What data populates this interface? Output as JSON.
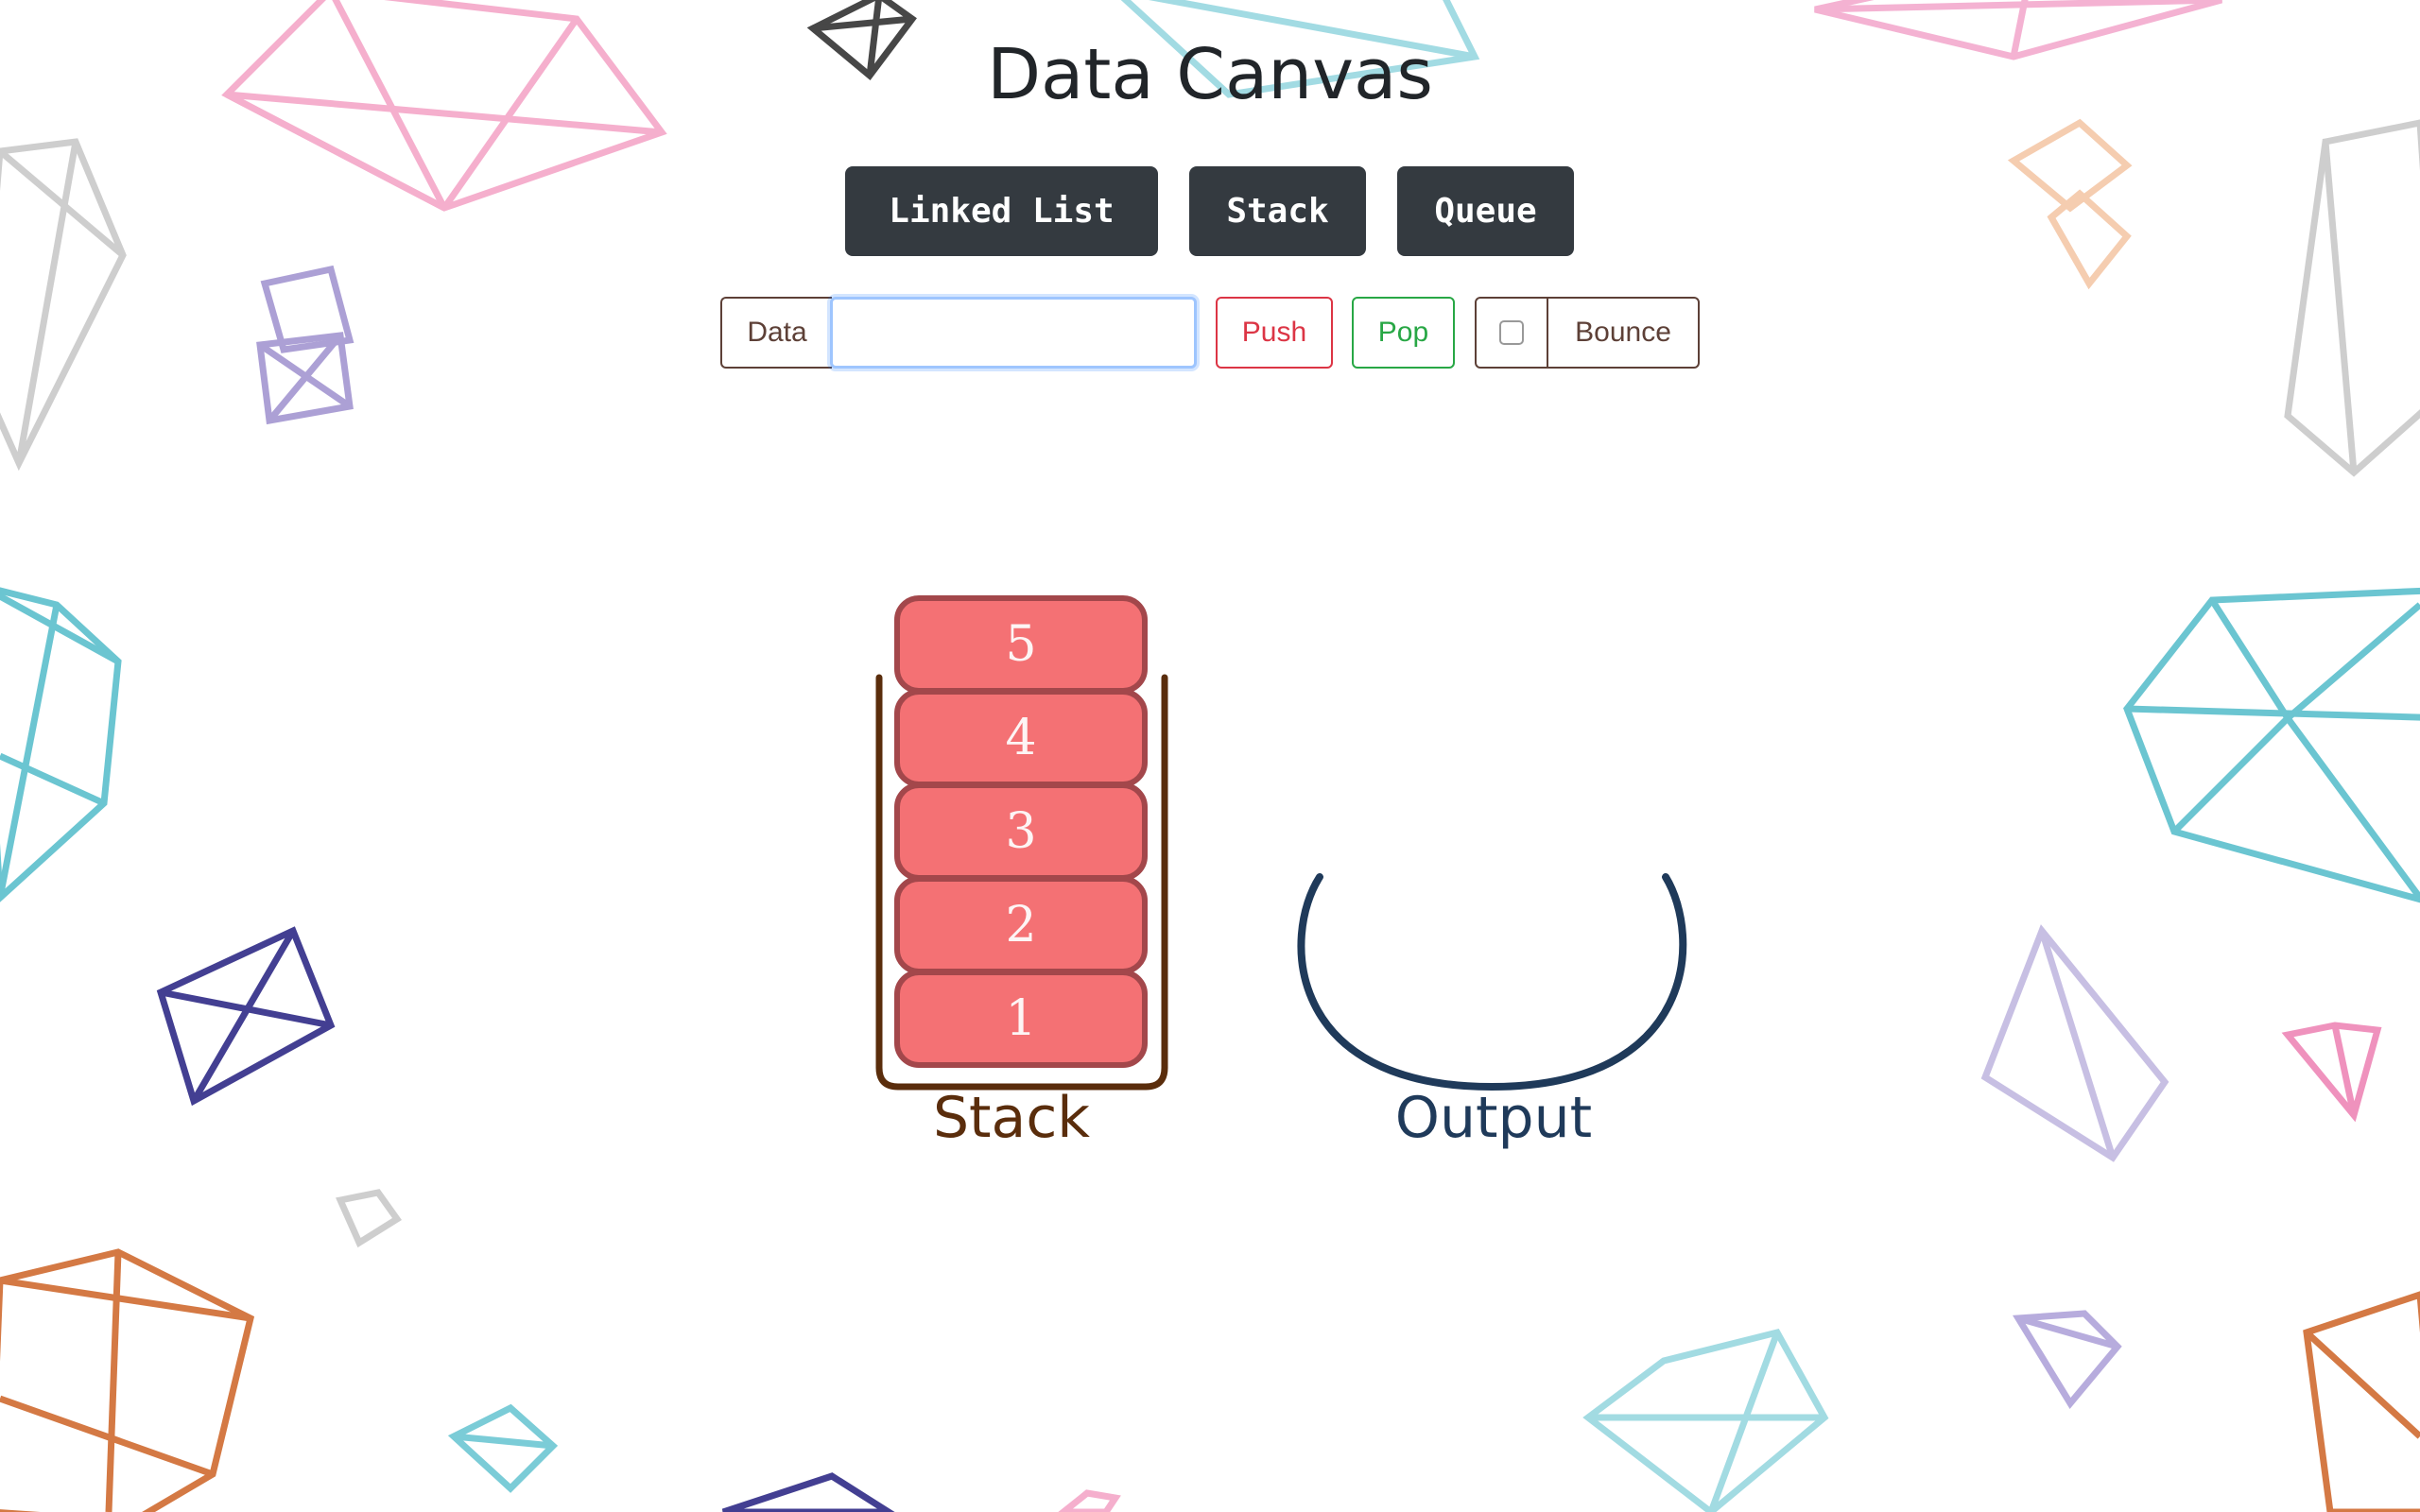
{
  "app": {
    "title": "Data Canvas"
  },
  "modes": {
    "linked_list": "Linked List",
    "stack": "Stack",
    "queue": "Queue"
  },
  "controls": {
    "data_label": "Data",
    "data_value": "",
    "push_label": "Push",
    "pop_label": "Pop",
    "bounce_label": "Bounce",
    "bounce_checked": false
  },
  "stack": {
    "label": "Stack",
    "items": [
      "5",
      "4",
      "3",
      "2",
      "1"
    ]
  },
  "output": {
    "label": "Output",
    "items": []
  },
  "colors": {
    "stack_item_fill": "#f47174",
    "stack_item_border": "#a3474b",
    "stack_container": "#5a2d0c",
    "output_container": "#1f3a5a",
    "push": "#dc3545",
    "pop": "#28a745",
    "mode_button": "#343a40"
  }
}
